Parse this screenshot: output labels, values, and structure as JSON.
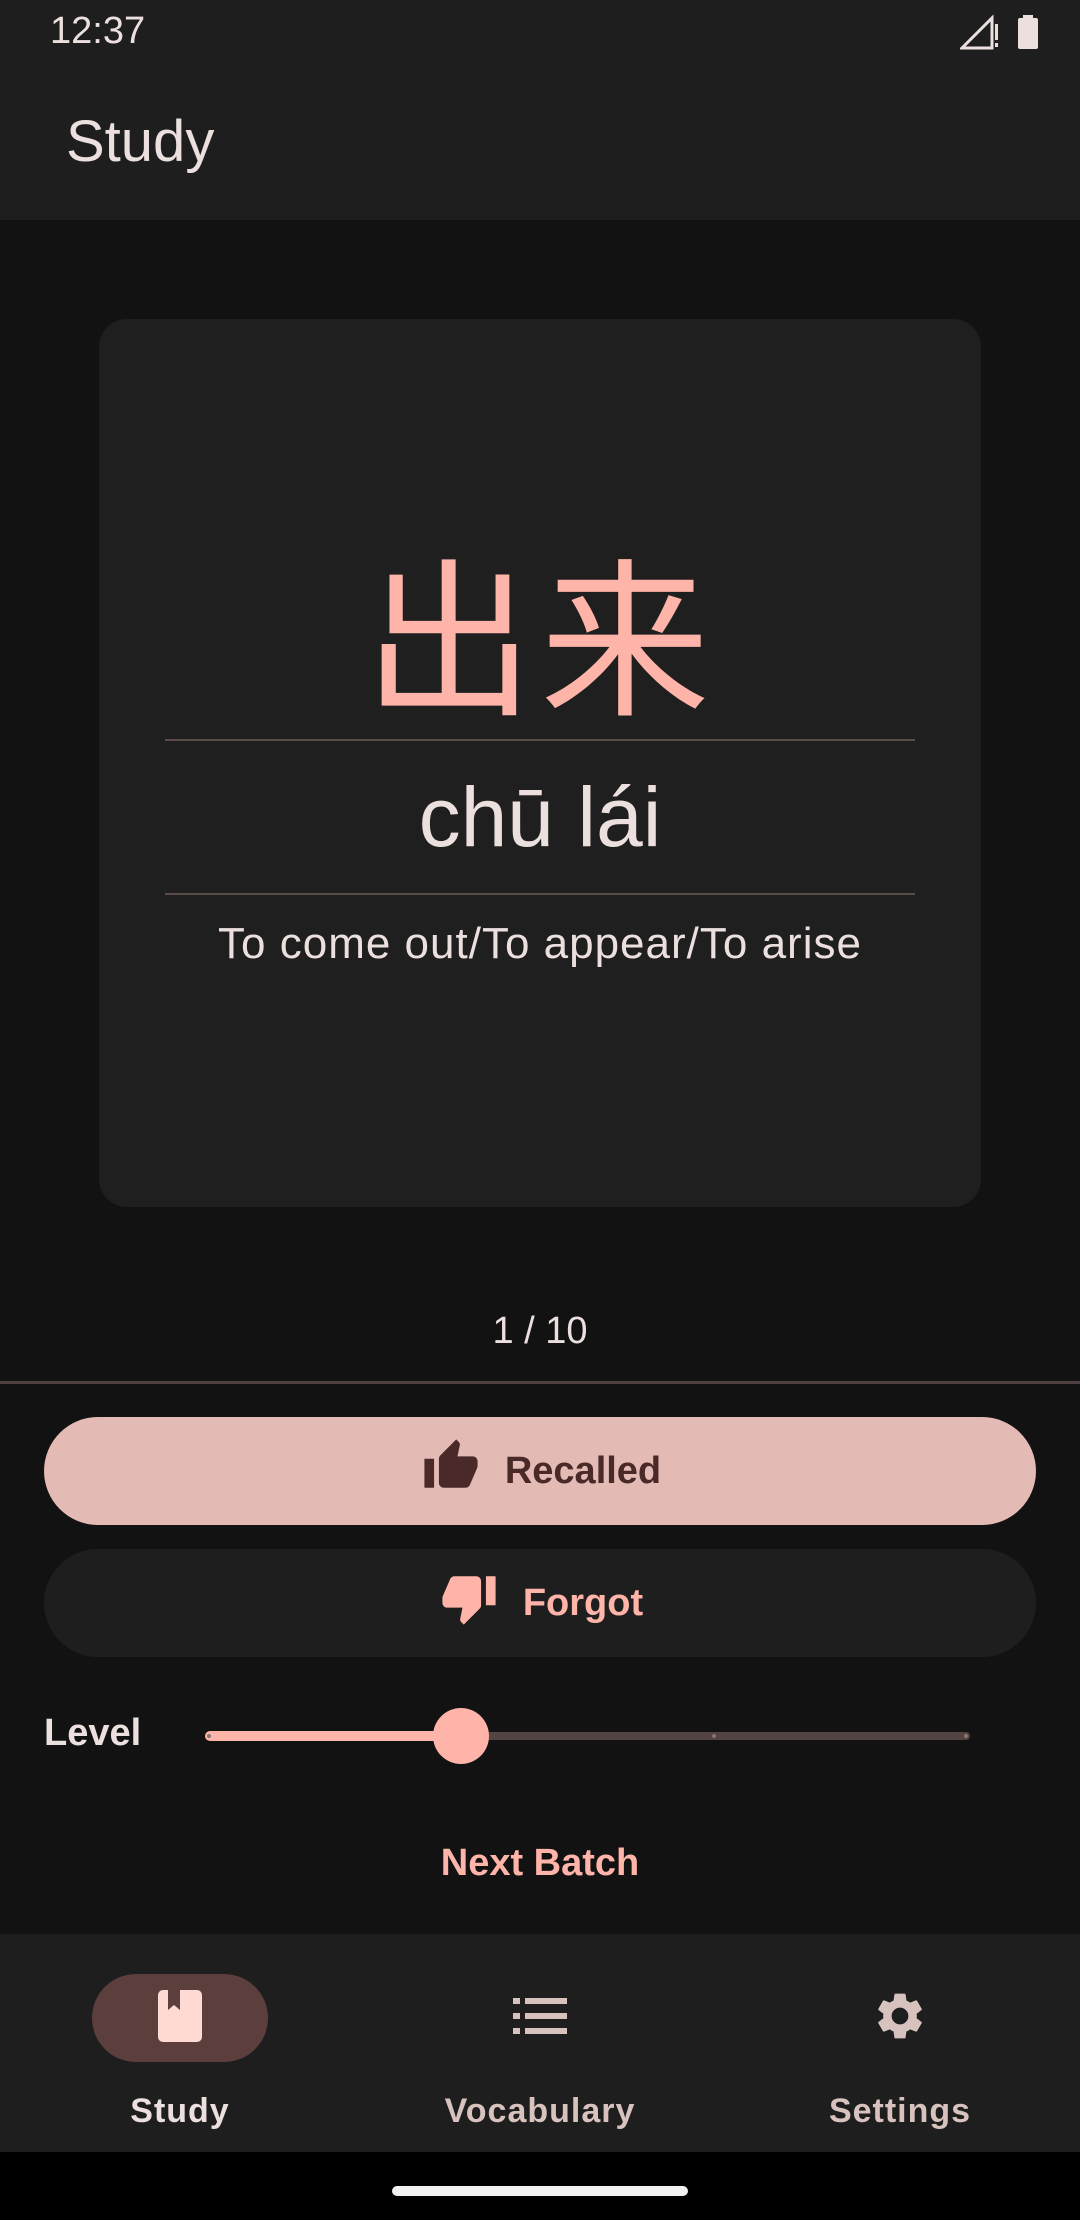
{
  "status_bar": {
    "time": "12:37"
  },
  "app_bar": {
    "title": "Study"
  },
  "card": {
    "hanzi": "出来",
    "pinyin": "chū lái",
    "meaning": "To come out/To appear/To arise"
  },
  "progress": {
    "counter": "1 / 10",
    "current": 1,
    "total": 10
  },
  "actions": {
    "recalled_label": "Recalled",
    "forgot_label": "Forgot"
  },
  "level": {
    "label": "Level",
    "value_fraction": 0.333,
    "steps": 3
  },
  "next_batch_label": "Next Batch",
  "bottom_nav": {
    "items": [
      {
        "label": "Study",
        "icon": "book-icon",
        "active": true
      },
      {
        "label": "Vocabulary",
        "icon": "list-icon",
        "active": false
      },
      {
        "label": "Settings",
        "icon": "gear-icon",
        "active": false
      }
    ]
  },
  "colors": {
    "accent": "#ffb4a9",
    "recalled_bg": "#e4bab5",
    "background": "#121212",
    "surface": "#1e1e1e"
  }
}
